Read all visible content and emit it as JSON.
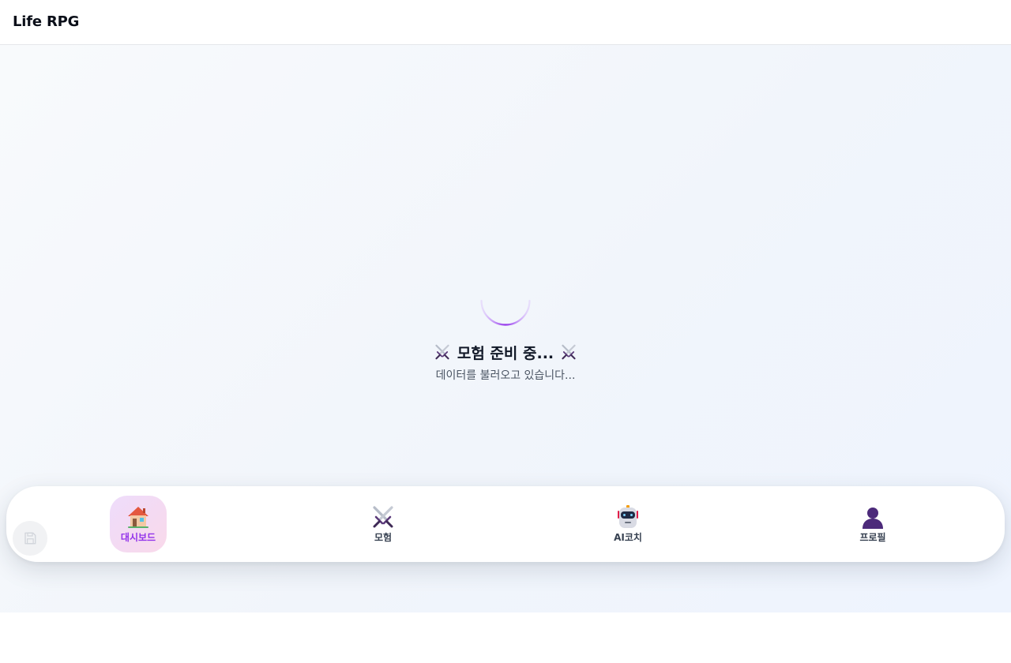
{
  "header": {
    "title": "Life RPG"
  },
  "loading": {
    "title": "모험 준비 중...",
    "subtitle": "데이터를 불러오고 있습니다...",
    "left_icon": "crossed-swords-icon",
    "right_icon": "crossed-swords-icon",
    "spinner_color": "#9333ea"
  },
  "nav": {
    "items": [
      {
        "label": "대시보드",
        "icon": "house-icon",
        "active": true
      },
      {
        "label": "모험",
        "icon": "crossed-swords-icon",
        "active": false
      },
      {
        "label": "AI코치",
        "icon": "robot-icon",
        "active": false
      },
      {
        "label": "프로필",
        "icon": "user-silhouette-icon",
        "active": false
      }
    ],
    "active_color": "#9333ea"
  },
  "save_button": {
    "icon": "floppy-disk-icon"
  }
}
